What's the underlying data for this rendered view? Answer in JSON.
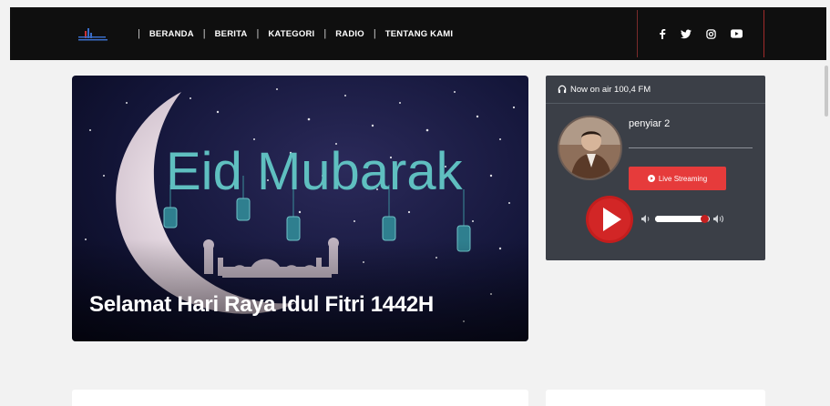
{
  "header": {
    "logo_text": "BLITAR MANDALA",
    "nav": [
      "BERANDA",
      "BERITA",
      "KATEGORI",
      "RADIO",
      "TENTANG KAMI"
    ],
    "social_icons": [
      "facebook-icon",
      "twitter-icon",
      "instagram-icon",
      "youtube-icon"
    ]
  },
  "hero": {
    "image_text": "Eid Mubarak",
    "title": "Selamat Hari Raya Idul Fitri 1442H"
  },
  "radio": {
    "now_on_air": "Now on air 100,4 FM",
    "announcer": "penyiar 2",
    "live_button": "Live Streaming",
    "volume_level": 0.9
  },
  "colors": {
    "navbar": "#0f0f0f",
    "accent_red": "#e63b3b",
    "radio_panel": "#3b3f47",
    "eid_text": "#5fbfc0"
  }
}
